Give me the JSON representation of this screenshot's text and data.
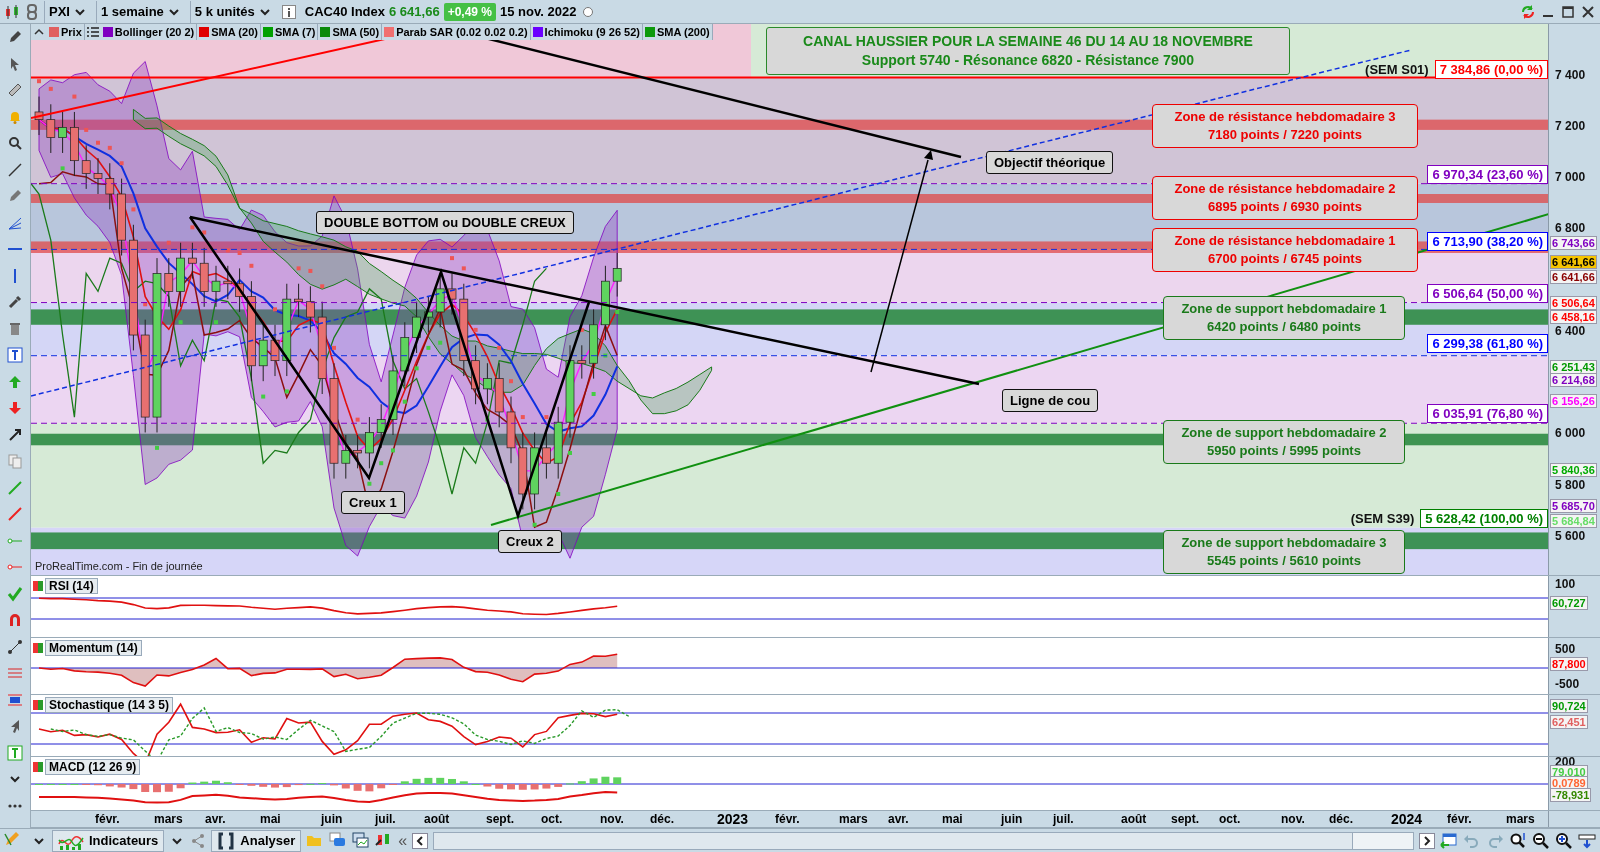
{
  "toolbar": {
    "symbol": "PXI",
    "period": "1 semaine",
    "units": "5 k unités",
    "instrument": "CAC40 Index",
    "price": "6 641,66",
    "change": "+0,49 %",
    "date": "15 nov. 2022"
  },
  "legend": [
    {
      "label": "Prix",
      "color": "#e06060"
    },
    {
      "label": "Bollinger (20 2)",
      "color": "#8000c0"
    },
    {
      "label": "SMA (20)",
      "color": "#e00000"
    },
    {
      "label": "SMA (7)",
      "color": "#00a000"
    },
    {
      "label": "SMA (50)",
      "color": "#0a8a0a"
    },
    {
      "label": "Parab SAR (0.02 0.02 0.2)",
      "color": "#f07070"
    },
    {
      "label": "Ichimoku (9 26 52)",
      "color": "#6a00ff"
    },
    {
      "label": "SMA (200)",
      "color": "#0c9a0c"
    }
  ],
  "main_chart": {
    "banner": [
      "CANAL HAUSSIER POUR LA SEMAINE 46 DU 14 AU 18 NOVEMBRE",
      "Support 5740 - Résonance 6820 - Résistance 7900"
    ],
    "fib_levels": [
      {
        "text": "7 384,86 (0,00 %)",
        "color": "#ff0000",
        "tag": "(SEM S01)"
      },
      {
        "text": "6 970,34 (23,60 %)",
        "color": "#8000c0"
      },
      {
        "text": "6 713,90 (38,20 %)",
        "color": "#0000ff"
      },
      {
        "text": "6 506,64 (50,00 %)",
        "color": "#8000c0"
      },
      {
        "text": "6 299,38 (61,80 %)",
        "color": "#0000ff"
      },
      {
        "text": "6 035,91 (76,80 %)",
        "color": "#8000c0"
      },
      {
        "text": "5 628,42 (100,00 %)",
        "color": "#008000",
        "tag": "(SEM S39)"
      }
    ],
    "zones": [
      {
        "kind": "resistance",
        "lines": [
          "Zone de résistance hebdomadaire 3",
          "7180 points / 7220 points"
        ]
      },
      {
        "kind": "resistance",
        "lines": [
          "Zone de résistance hebdomadaire 2",
          "6895 points / 6930 points"
        ]
      },
      {
        "kind": "resistance",
        "lines": [
          "Zone de résistance hebdomadaire 1",
          "6700 points / 6745 points"
        ]
      },
      {
        "kind": "support",
        "lines": [
          "Zone de support hebdomadaire 1",
          "6420 points / 6480 points"
        ]
      },
      {
        "kind": "support",
        "lines": [
          "Zone de support hebdomadaire 2",
          "5950 points / 5995 points"
        ]
      },
      {
        "kind": "support",
        "lines": [
          "Zone de support hebdomadaire 3",
          "5545 points / 5610 points"
        ]
      }
    ],
    "callouts": [
      "Objectif théorique",
      "DOUBLE BOTTOM ou DOUBLE CREUX",
      "Ligne de cou",
      "Creux 1",
      "Creux 2"
    ],
    "source": "ProRealTime.com - Fin de journée",
    "axis_ticks": [
      "7 400",
      "7 200",
      "7 000",
      "6 800",
      "6 400",
      "6 000",
      "5 800",
      "5 600"
    ],
    "axis_badges": [
      {
        "text": "6 743,66",
        "color": "#8000c0",
        "kind": "plain"
      },
      {
        "text": "6 641,66",
        "color": "#f5c400",
        "kind": "highlight"
      },
      {
        "text": "6 641,66",
        "color": "#8b0000",
        "kind": "plain"
      },
      {
        "text": "6 506,64",
        "color": "#ff0000",
        "kind": "plain"
      },
      {
        "text": "6 458,16",
        "color": "#ff0000",
        "kind": "plain"
      },
      {
        "text": "6 251,43",
        "color": "#009900",
        "kind": "plain"
      },
      {
        "text": "6 214,68",
        "color": "#8000c0",
        "kind": "plain"
      },
      {
        "text": "6 156,26",
        "color": "#ff00ff",
        "kind": "plain"
      },
      {
        "text": "5 840,36",
        "color": "#00aa00",
        "kind": "plain"
      },
      {
        "text": "5 685,70",
        "color": "#8000c0",
        "kind": "plain"
      },
      {
        "text": "5 684,84",
        "color": "#66dd66",
        "kind": "plain"
      }
    ]
  },
  "indicators": [
    {
      "kind": "rsi",
      "title": "RSI (14)",
      "ticks": [
        "100"
      ],
      "badges": [
        {
          "text": "60,727",
          "color": "#009900"
        }
      ]
    },
    {
      "kind": "momentum",
      "title": "Momentum (14)",
      "ticks": [
        "500",
        "-500"
      ],
      "badges": [
        {
          "text": "87,800",
          "color": "#ff0000"
        }
      ]
    },
    {
      "kind": "stochastic",
      "title": "Stochastique (14 3 5)",
      "badges": [
        {
          "text": "90,724",
          "color": "#009900"
        },
        {
          "text": "62,451",
          "color": "#e06060"
        }
      ]
    },
    {
      "kind": "macd",
      "title": "MACD (12 26 9)",
      "ticks": [
        "200"
      ],
      "badges": [
        {
          "text": "79,010",
          "color": "#44cc44"
        },
        {
          "text": "0,0789",
          "color": "#ff6633"
        },
        {
          "text": "-78,931",
          "color": "#338800"
        }
      ]
    }
  ],
  "time_axis": [
    {
      "label": "févr.",
      "kind": "month"
    },
    {
      "label": "mars",
      "kind": "month"
    },
    {
      "label": "avr.",
      "kind": "month"
    },
    {
      "label": "mai",
      "kind": "month"
    },
    {
      "label": "juin",
      "kind": "month"
    },
    {
      "label": "juil.",
      "kind": "month"
    },
    {
      "label": "août",
      "kind": "month"
    },
    {
      "label": "sept.",
      "kind": "month"
    },
    {
      "label": "oct.",
      "kind": "month"
    },
    {
      "label": "nov.",
      "kind": "month"
    },
    {
      "label": "déc.",
      "kind": "month"
    },
    {
      "label": "2023",
      "kind": "year"
    },
    {
      "label": "févr.",
      "kind": "month"
    },
    {
      "label": "mars",
      "kind": "month"
    },
    {
      "label": "avr.",
      "kind": "month"
    },
    {
      "label": "mai",
      "kind": "month"
    },
    {
      "label": "juin",
      "kind": "month"
    },
    {
      "label": "juil.",
      "kind": "month"
    },
    {
      "label": "août",
      "kind": "month"
    },
    {
      "label": "sept.",
      "kind": "month"
    },
    {
      "label": "oct.",
      "kind": "month"
    },
    {
      "label": "nov.",
      "kind": "month"
    },
    {
      "label": "déc.",
      "kind": "month"
    },
    {
      "label": "2024",
      "kind": "year"
    },
    {
      "label": "févr.",
      "kind": "month"
    },
    {
      "label": "mars",
      "kind": "month"
    }
  ],
  "bottom_bar": {
    "indicators_button": "Indicateurs",
    "analyze_button": "Analyser",
    "rewind": "«"
  }
}
